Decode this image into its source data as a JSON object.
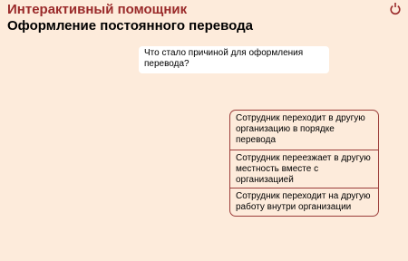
{
  "header": {
    "app_title": "Интерактивный помощник",
    "page_title": "Оформление постоянного перевода"
  },
  "toolbar": {
    "restart_icon": "restart-icon"
  },
  "question": {
    "text": "Что стало причиной для оформления перевода?"
  },
  "answers": [
    {
      "label": "Сотрудник переходит в другую организацию в порядке перевода"
    },
    {
      "label": "Сотрудник переезжает в другую местность вместе с организацией"
    },
    {
      "label": "Сотрудник переходит на другую работу внутри организации"
    }
  ],
  "colors": {
    "background": "#fdebdb",
    "accent": "#9a2a2a",
    "border": "#9b3d3a"
  }
}
